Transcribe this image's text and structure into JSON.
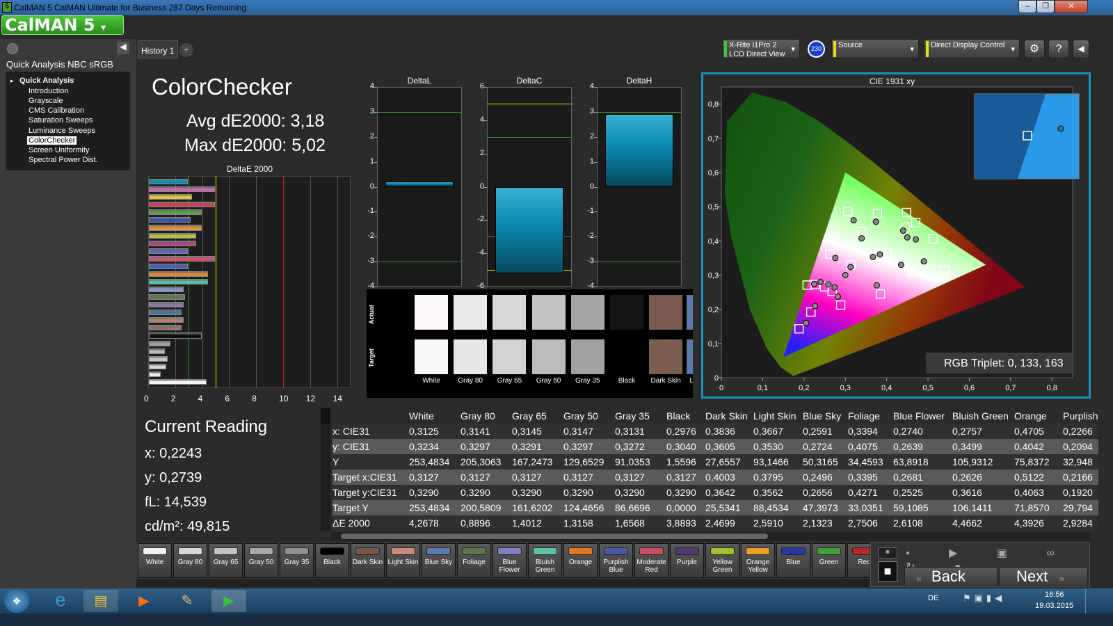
{
  "window": {
    "title": "CalMAN 5 CalMAN Ultimate for Business 287 Days Remaining",
    "app_icon": "5",
    "min": "–",
    "max": "❐",
    "close": "✕"
  },
  "logo": "CalMAN 5",
  "sidebar": {
    "workflow_title": "Quick Analysis NBC sRGB",
    "root": "Quick Analysis",
    "items": [
      "Introduction",
      "Grayscale",
      "CMS Calibration",
      "Saturation Sweeps",
      "Luminance Sweeps",
      "ColorChecker",
      "Screen Uniformity",
      "Spectral Power Dist."
    ],
    "selected": "ColorChecker"
  },
  "tabs": {
    "history": "History 1",
    "add": "+"
  },
  "devices": {
    "meter_line1": "X-Rite i1Pro 2",
    "meter_line2": "LCD Direct View",
    "meter_badge": "230",
    "source": "Source",
    "display": "Direct Display Control"
  },
  "colors": {
    "cyan": "#0b8eb4",
    "gamut_border": "#1994bf",
    "yellow_line": "#e6e600",
    "green_line": "#2e9b2e",
    "red_line": "#d02020"
  },
  "header": {
    "title": "ColorChecker",
    "avg": "Avg dE2000: 3,18",
    "max": "Max dE2000: 5,02"
  },
  "reading": {
    "title": "Current Reading",
    "x": "x: 0,2243",
    "y": "y: 0,2739",
    "fl": "fL: 14,539",
    "cd": "cd/m²: 49,815"
  },
  "chart_data": [
    {
      "type": "bar",
      "title": "DeltaE 2000",
      "orientation": "horizontal",
      "xlim": [
        0,
        15
      ],
      "xticks": [
        "0",
        "2",
        "4",
        "6",
        "8",
        "10",
        "12",
        "14"
      ],
      "values": [
        2.9,
        4.9,
        3.2,
        4.9,
        3.9,
        3.1,
        3.9,
        3.5,
        3.5,
        2.9,
        4.9,
        2.9,
        4.4,
        4.4,
        2.6,
        2.7,
        2.6,
        2.4,
        2.6,
        2.4,
        3.9,
        1.6,
        1.2,
        1.4,
        1.3,
        0.9,
        4.3
      ],
      "colors": [
        "#0b8eb4",
        "#c868a8",
        "#e8c040",
        "#c84050",
        "#58a048",
        "#4050b0",
        "#e09040",
        "#b8c040",
        "#b04080",
        "#5868b8",
        "#d05070",
        "#4060c0",
        "#e08a30",
        "#50c0a0",
        "#8898c8",
        "#607850",
        "#8878a0",
        "#4078a0",
        "#b88070",
        "#987060",
        "#101010",
        "#a0a0a0",
        "#b8b8b8",
        "#c8c8c8",
        "#d8d8d8",
        "#e8e8e8",
        "#f5f5f5"
      ],
      "thresholds": [
        3,
        5,
        10
      ]
    },
    {
      "type": "bar",
      "title": "DeltaL",
      "ylim": [
        -4,
        4
      ],
      "yticks": [
        "4",
        "3",
        "2",
        "1",
        "0",
        "-1",
        "-2",
        "-3",
        "-4"
      ],
      "value": 0.2
    },
    {
      "type": "bar",
      "title": "DeltaC",
      "ylim": [
        -6,
        6
      ],
      "yticks": [
        "6",
        "4",
        "2",
        "0",
        "-2",
        "-4",
        "-6"
      ],
      "value": -5.2
    },
    {
      "type": "bar",
      "title": "DeltaH",
      "ylim": [
        -4,
        4
      ],
      "yticks": [
        "4",
        "3",
        "2",
        "1",
        "0",
        "-1",
        "-2",
        "-3",
        "-4"
      ],
      "value": 2.9
    },
    {
      "type": "scatter",
      "title": "CIE 1931 xy",
      "xlim": [
        0,
        0.85
      ],
      "ylim": [
        0,
        0.85
      ],
      "xticks": [
        "0",
        "0,1",
        "0,2",
        "0,3",
        "0,4",
        "0,5",
        "0,6",
        "0,7",
        "0,8"
      ],
      "yticks": [
        "0,8",
        "0,7",
        "0,6",
        "0,5",
        "0,4",
        "0,3",
        "0,2",
        "0,1",
        "0"
      ],
      "gamut": [
        [
          0.64,
          0.33
        ],
        [
          0.3,
          0.6
        ],
        [
          0.15,
          0.06
        ]
      ],
      "targets": [
        [
          0.3127,
          0.329
        ],
        [
          0.4003,
          0.3642
        ],
        [
          0.3795,
          0.3562
        ],
        [
          0.2496,
          0.2656
        ],
        [
          0.3395,
          0.4271
        ],
        [
          0.2681,
          0.2525
        ],
        [
          0.2626,
          0.3616
        ],
        [
          0.5122,
          0.4063
        ],
        [
          0.2166,
          0.192
        ],
        [
          0.462,
          0.31
        ],
        [
          0.2887,
          0.2124
        ],
        [
          0.3777,
          0.4803
        ],
        [
          0.4702,
          0.4531
        ],
        [
          0.188,
          0.143
        ],
        [
          0.3059,
          0.4863
        ],
        [
          0.5399,
          0.3135
        ],
        [
          0.4481,
          0.4828
        ],
        [
          0.3851,
          0.2447
        ],
        [
          0.2077,
          0.2707
        ],
        [
          0.2272,
          0.2724
        ],
        [
          0.445,
          0.44
        ]
      ],
      "actuals": [
        [
          0.3125,
          0.3234
        ],
        [
          0.3836,
          0.3605
        ],
        [
          0.3667,
          0.353
        ],
        [
          0.2591,
          0.2724
        ],
        [
          0.3394,
          0.4075
        ],
        [
          0.274,
          0.2639
        ],
        [
          0.2757,
          0.3499
        ],
        [
          0.4705,
          0.4042
        ],
        [
          0.2266,
          0.2094
        ],
        [
          0.435,
          0.33
        ],
        [
          0.282,
          0.237
        ],
        [
          0.374,
          0.456
        ],
        [
          0.44,
          0.43
        ],
        [
          0.205,
          0.16
        ],
        [
          0.32,
          0.46
        ],
        [
          0.49,
          0.34
        ],
        [
          0.45,
          0.41
        ],
        [
          0.376,
          0.27
        ],
        [
          0.24,
          0.28
        ],
        [
          0.2243,
          0.2739
        ],
        [
          0.3,
          0.3
        ]
      ],
      "rgb_triplet": "RGB Triplet: 0, 133, 163"
    }
  ],
  "swatches": {
    "labels": [
      "White",
      "Gray 80",
      "Gray 65",
      "Gray 50",
      "Gray 35",
      "Black",
      "Dark Skin",
      "Light Skin"
    ],
    "actual": [
      "#fcf8fc",
      "#e9e9e9",
      "#d9d9d9",
      "#c2c2c2",
      "#a6a6a6",
      "#151515",
      "#7a5a50",
      "#c89c8c"
    ],
    "target": [
      "#f8f8f8",
      "#e6e6e6",
      "#d2d2d2",
      "#bcbcbc",
      "#a2a2a2",
      "#000000",
      "#7c5d52",
      "#c69886"
    ],
    "actual_label": "Actual",
    "target_label": "Target"
  },
  "table": {
    "columns": [
      "",
      "White",
      "Gray 80",
      "Gray 65",
      "Gray 50",
      "Gray 35",
      "Black",
      "Dark Skin",
      "Light Skin",
      "Blue Sky",
      "Foliage",
      "Blue Flower",
      "Bluish Green",
      "Orange",
      "Purplish"
    ],
    "rows": [
      [
        "x: CIE31",
        "0,3125",
        "0,3141",
        "0,3145",
        "0,3147",
        "0,3131",
        "0,2976",
        "0,3836",
        "0,3667",
        "0,2591",
        "0,3394",
        "0,2740",
        "0,2757",
        "0,4705",
        "0,2266"
      ],
      [
        "y: CIE31",
        "0,3234",
        "0,3297",
        "0,3291",
        "0,3297",
        "0,3272",
        "0,3040",
        "0,3605",
        "0,3530",
        "0,2724",
        "0,4075",
        "0,2639",
        "0,3499",
        "0,4042",
        "0,2094"
      ],
      [
        "Y",
        "253,4834",
        "205,3063",
        "167,2473",
        "129,6529",
        "91,0353",
        "1,5596",
        "27,6557",
        "93,1466",
        "50,3165",
        "34,4593",
        "63,8918",
        "105,9312",
        "75,8372",
        "32,948"
      ],
      [
        "Target x:CIE31",
        "0,3127",
        "0,3127",
        "0,3127",
        "0,3127",
        "0,3127",
        "0,3127",
        "0,4003",
        "0,3795",
        "0,2496",
        "0,3395",
        "0,2681",
        "0,2626",
        "0,5122",
        "0,2166"
      ],
      [
        "Target y:CIE31",
        "0,3290",
        "0,3290",
        "0,3290",
        "0,3290",
        "0,3290",
        "0,3290",
        "0,3642",
        "0,3562",
        "0,2656",
        "0,4271",
        "0,2525",
        "0,3616",
        "0,4063",
        "0,1920"
      ],
      [
        "Target Y",
        "253,4834",
        "200,5809",
        "161,6202",
        "124,4656",
        "86,6696",
        "0,0000",
        "25,5341",
        "88,4534",
        "47,3973",
        "33,0351",
        "59,1085",
        "106,1411",
        "71,8570",
        "29,794"
      ],
      [
        "ΔE 2000",
        "4,2678",
        "0,8896",
        "1,4012",
        "1,3158",
        "1,6568",
        "3,8893",
        "2,4699",
        "2,5910",
        "2,1323",
        "2,7506",
        "2,6108",
        "4,4662",
        "4,3926",
        "2,9284"
      ]
    ]
  },
  "toolbar": {
    "buttons": [
      {
        "l1": "White",
        "l2": "",
        "c": "#f0f0f0"
      },
      {
        "l1": "Gray 80",
        "l2": "",
        "c": "#d8d8d8"
      },
      {
        "l1": "Gray 65",
        "l2": "",
        "c": "#c4c4c4"
      },
      {
        "l1": "Gray 50",
        "l2": "",
        "c": "#a8a8a8"
      },
      {
        "l1": "Gray 35",
        "l2": "",
        "c": "#909090"
      },
      {
        "l1": "Black",
        "l2": "",
        "c": "#000000"
      },
      {
        "l1": "Dark Skin",
        "l2": "",
        "c": "#7a5548"
      },
      {
        "l1": "Light Skin",
        "l2": "",
        "c": "#c88c78"
      },
      {
        "l1": "Blue Sky",
        "l2": "",
        "c": "#5a7cb0"
      },
      {
        "l1": "Foliage",
        "l2": "",
        "c": "#5a7848"
      },
      {
        "l1": "Blue",
        "l2": "Flower",
        "c": "#8080c0"
      },
      {
        "l1": "Bluish",
        "l2": "Green",
        "c": "#60c0a8"
      },
      {
        "l1": "Orange",
        "l2": "",
        "c": "#e07820"
      },
      {
        "l1": "Purplish",
        "l2": "Blue",
        "c": "#4858a8"
      },
      {
        "l1": "Moderate",
        "l2": "Red",
        "c": "#c85060"
      },
      {
        "l1": "Purple",
        "l2": "",
        "c": "#583870"
      },
      {
        "l1": "Yellow",
        "l2": "Green",
        "c": "#a0c030"
      },
      {
        "l1": "Orange",
        "l2": "Yellow",
        "c": "#e8a028"
      },
      {
        "l1": "Blue",
        "l2": "",
        "c": "#2838a0"
      },
      {
        "l1": "Green",
        "l2": "",
        "c": "#40a040"
      },
      {
        "l1": "Red",
        "l2": "",
        "c": "#b82828"
      }
    ],
    "back": "Back",
    "next": "Next"
  },
  "taskbar": {
    "lang": "DE",
    "time": "16:56",
    "date": "19.03.2015"
  }
}
